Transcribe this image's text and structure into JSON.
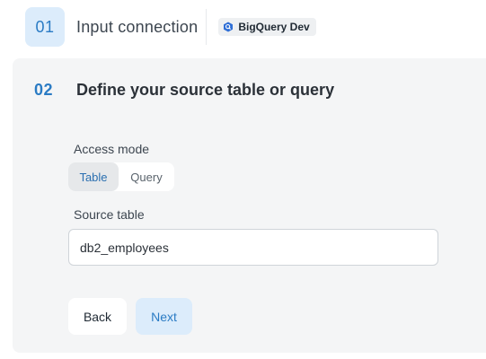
{
  "step1": {
    "number": "01",
    "title": "Input connection",
    "connection_badge": "BigQuery Dev",
    "connection_icon": "bigquery-icon"
  },
  "step2": {
    "number": "02",
    "title": "Define your source table or query",
    "access_mode": {
      "label": "Access mode",
      "options": [
        "Table",
        "Query"
      ],
      "selected": "Table"
    },
    "source_table": {
      "label": "Source table",
      "value": "db2_employees"
    },
    "buttons": {
      "back": "Back",
      "next": "Next"
    }
  },
  "colors": {
    "accent": "#2a7bc4",
    "accent_bg": "#dcecfb",
    "panel_bg": "#f4f5f6"
  }
}
